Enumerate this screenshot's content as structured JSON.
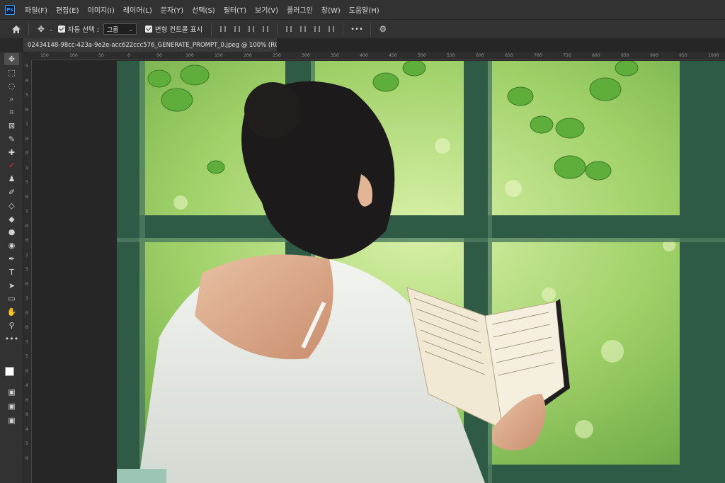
{
  "menubar": {
    "items": [
      "파일(F)",
      "편집(E)",
      "이미지(I)",
      "레이어(L)",
      "문자(Y)",
      "선택(S)",
      "필터(T)",
      "보기(V)",
      "플러그인",
      "창(W)",
      "도움말(H)"
    ]
  },
  "options": {
    "auto_select_label": "자동 선택 :",
    "auto_select_value": "그룹",
    "transform_label": "변형 컨트롤 표시",
    "more_label": "•••"
  },
  "document": {
    "tab_title": "02434148-98cc-423a-9e2e-acc622ccc576_GENERATE_PROMPT_0.jpeg @ 100% (RGB/8#)",
    "close_glyph": "×"
  },
  "ruler": {
    "top_labels": [
      "150",
      "100",
      "50",
      "0",
      "50",
      "100",
      "150",
      "200",
      "250",
      "300",
      "350",
      "400",
      "450",
      "500",
      "550",
      "600",
      "650",
      "700",
      "750",
      "800",
      "850",
      "900",
      "950",
      "1000"
    ],
    "left_labels": [
      "5",
      "0",
      "5",
      "0",
      "1",
      "0",
      "0",
      "1",
      "5",
      "0",
      "2",
      "0",
      "0",
      "2",
      "5",
      "0",
      "3",
      "0",
      "0",
      "3",
      "5",
      "0",
      "4",
      "0",
      "0",
      "4",
      "5",
      "0"
    ]
  },
  "tools": [
    {
      "icon": "move-icon",
      "glyph": "✥"
    },
    {
      "icon": "marquee-icon",
      "glyph": "⬚"
    },
    {
      "icon": "lasso-icon",
      "glyph": "◌"
    },
    {
      "icon": "quick-select-icon",
      "glyph": "⌕"
    },
    {
      "icon": "crop-icon",
      "glyph": "⌗"
    },
    {
      "icon": "frame-icon",
      "glyph": "⊠"
    },
    {
      "icon": "eyedropper-icon",
      "glyph": "✎"
    },
    {
      "icon": "healing-icon",
      "glyph": "✚"
    },
    {
      "icon": "brush-icon",
      "glyph": "✓"
    },
    {
      "icon": "clone-stamp-icon",
      "glyph": "♟"
    },
    {
      "icon": "history-brush-icon",
      "glyph": "✐"
    },
    {
      "icon": "eraser-icon",
      "glyph": "◇"
    },
    {
      "icon": "gradient-icon",
      "glyph": "◆"
    },
    {
      "icon": "blur-icon",
      "glyph": "●"
    },
    {
      "icon": "dodge-icon",
      "glyph": "◉"
    },
    {
      "icon": "pen-icon",
      "glyph": "✒"
    },
    {
      "icon": "type-icon",
      "glyph": "T"
    },
    {
      "icon": "path-select-icon",
      "glyph": "➤"
    },
    {
      "icon": "rectangle-icon",
      "glyph": "▭"
    },
    {
      "icon": "hand-icon",
      "glyph": "✋"
    },
    {
      "icon": "zoom-icon",
      "glyph": "⚲"
    },
    {
      "icon": "more-tools-icon",
      "glyph": "•••"
    }
  ],
  "colors": {
    "accent_check": "#e0262b",
    "ps_blue": "#3aa1ff"
  }
}
